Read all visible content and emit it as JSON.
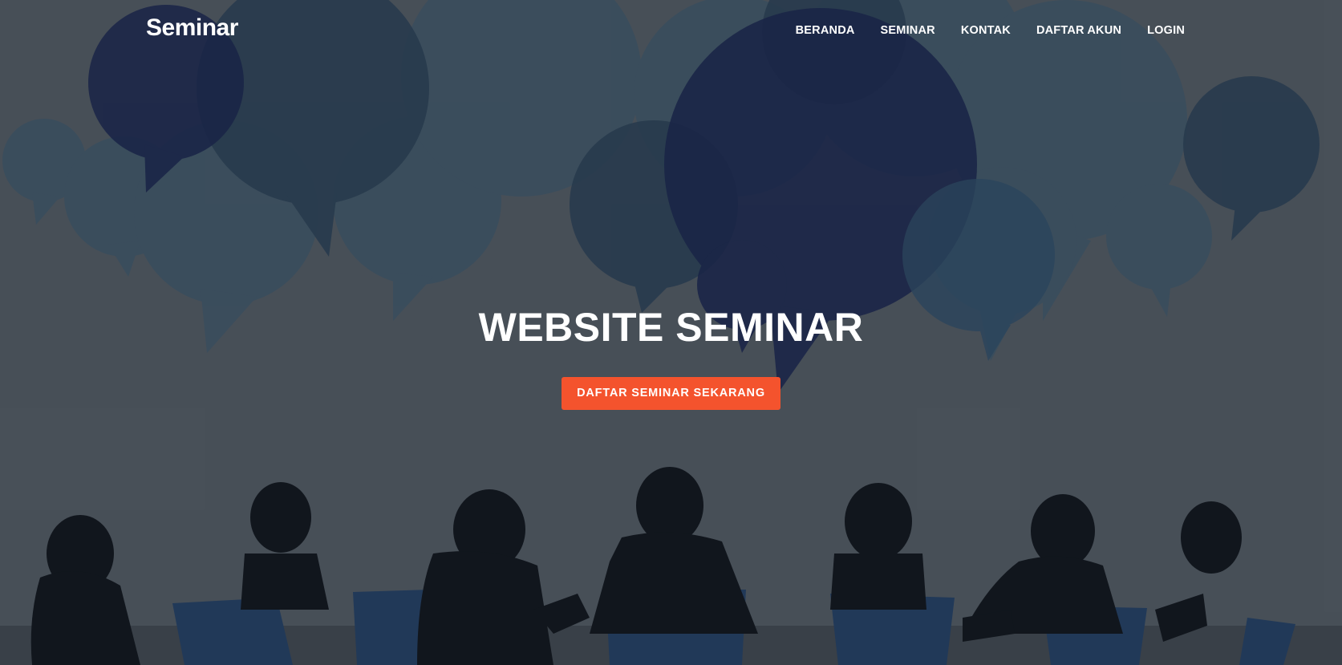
{
  "navbar": {
    "brand": "Seminar",
    "links": [
      "BERANDA",
      "SEMINAR",
      "KONTAK",
      "DAFTAR AKUN",
      "LOGIN"
    ]
  },
  "hero": {
    "title": "WEBSITE SEMINAR",
    "cta_label": "DAFTAR SEMINAR SEKARANG"
  },
  "colors": {
    "accent": "#f4532d",
    "background": "#4e565e",
    "bubble_navy": "#16224a",
    "bubble_teal": "#2e4a5e",
    "chair_blue": "#1f3a5e",
    "silhouette": "#0d1218"
  },
  "background_image": "speech-bubbles-and-audience-silhouette"
}
